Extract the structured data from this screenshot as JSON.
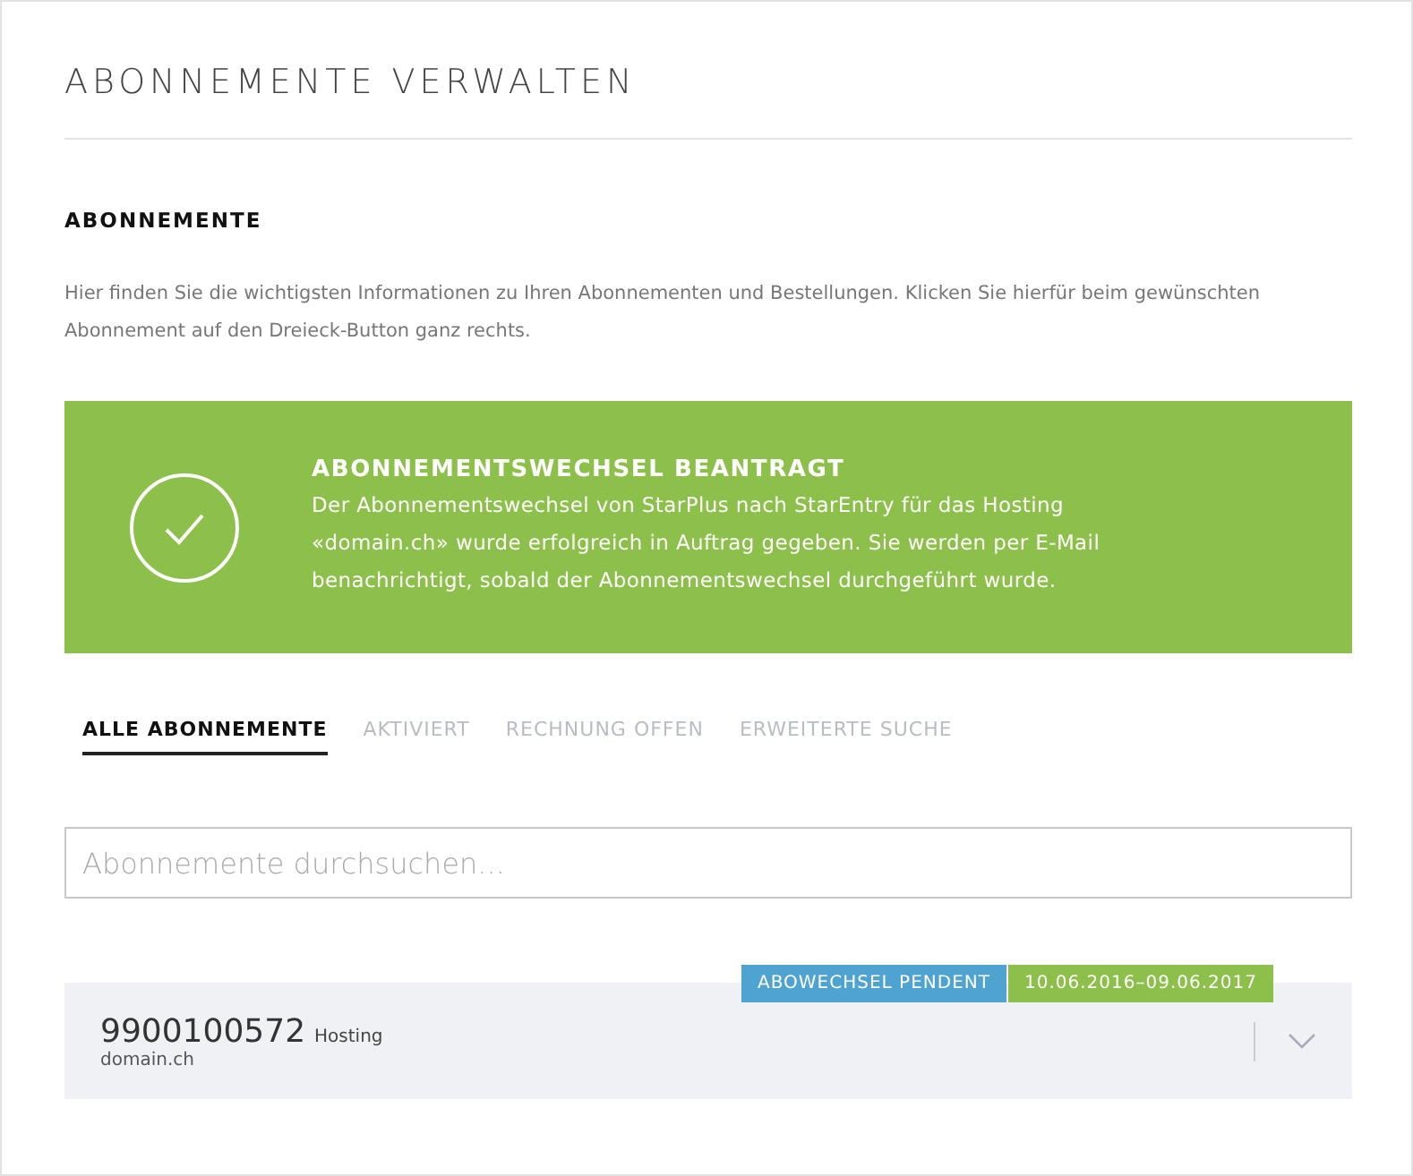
{
  "page": {
    "title": "ABONNEMENTE VERWALTEN"
  },
  "section": {
    "heading": "ABONNEMENTE",
    "description": "Hier finden Sie die wichtigsten Informationen zu Ihren Abonnementen und Bestellungen. Klicken Sie hierfür beim gewünschten Abonnement auf den Dreieck-Button ganz rechts."
  },
  "notice": {
    "kind": "success",
    "title": "ABONNEMENTSWECHSEL BEANTRAGT",
    "message": "Der Abonnementswechsel von StarPlus nach StarEntry für das Hosting «domain.ch» wurde erfolgreich in Auftrag gegeben. Sie werden per E-Mail benachrichtigt, sobald der Abonnementswechsel durchgeführt wurde."
  },
  "tabs": [
    {
      "label": "ALLE ABONNEMENTE",
      "selected": true
    },
    {
      "label": "AKTIVIERT",
      "selected": false
    },
    {
      "label": "RECHNUNG OFFEN",
      "selected": false
    },
    {
      "label": "ERWEITERTE SUCHE",
      "selected": false
    }
  ],
  "search": {
    "placeholder": "Abonnemente durchsuchen..."
  },
  "subscriptions": [
    {
      "number": "9900100572",
      "type": "Hosting",
      "domain": "domain.ch",
      "expanded": false,
      "badges": [
        {
          "label": "ABOWECHSEL PENDENT",
          "color": "#4fa3d1"
        },
        {
          "label": "10.06.2016–09.06.2017",
          "color": "#8dc04a"
        }
      ]
    }
  ]
}
